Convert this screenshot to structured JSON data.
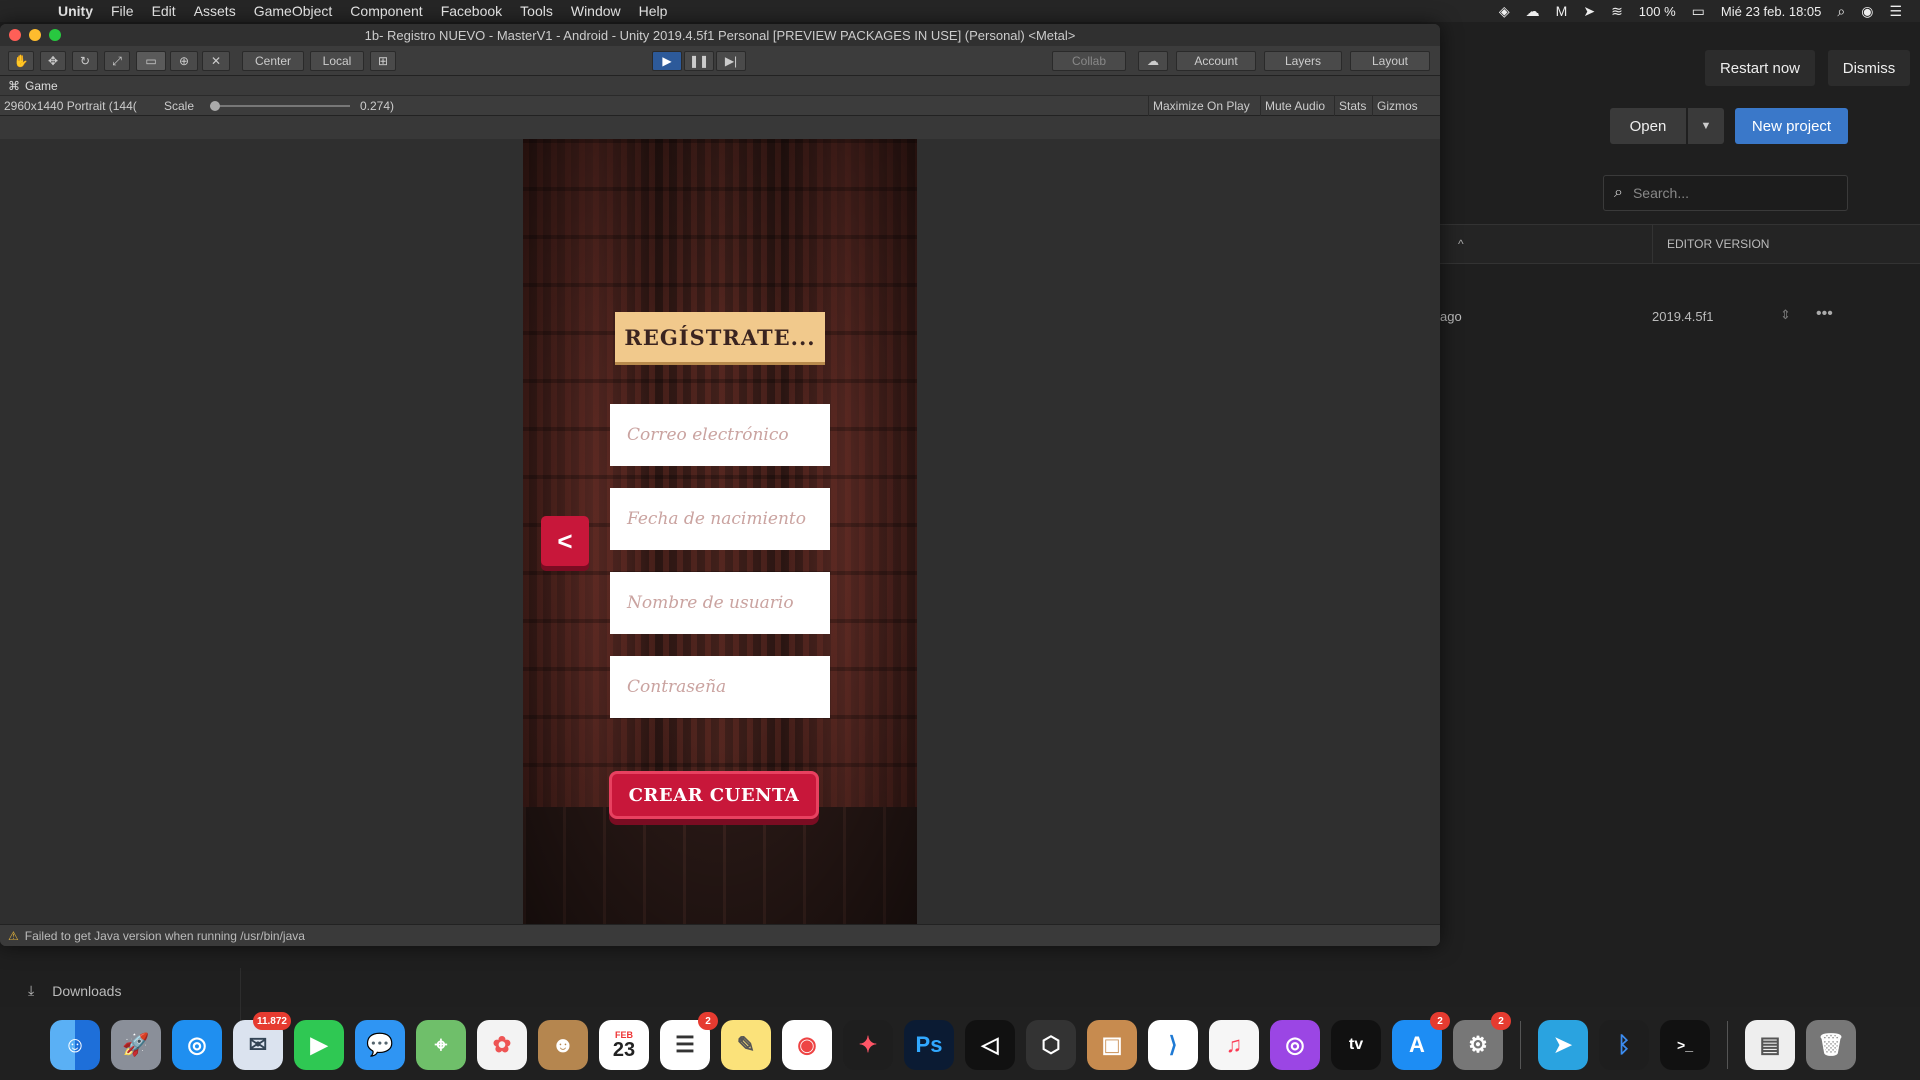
{
  "menubar": {
    "app": "Unity",
    "items": [
      "File",
      "Edit",
      "Assets",
      "GameObject",
      "Component",
      "Facebook",
      "Tools",
      "Window",
      "Help"
    ],
    "battery": "100 %",
    "datetime": "Mié 23 feb.  18:05"
  },
  "hub": {
    "restart": "Restart now",
    "dismiss": "Dismiss",
    "open": "Open",
    "new_project": "New project",
    "search_placeholder": "Search...",
    "editor_version_header": "EDITOR VERSION",
    "row_ago": "ago",
    "row_version": "2019.4.5f1",
    "downloads": "Downloads"
  },
  "unity": {
    "title": "1b- Registro NUEVO - MasterV1 - Android - Unity 2019.4.5f1 Personal [PREVIEW PACKAGES IN USE] (Personal) <Metal>",
    "toolbar": {
      "center": "Center",
      "local": "Local",
      "collab": "Collab",
      "account": "Account",
      "layers": "Layers",
      "layout": "Layout"
    },
    "game_tab": "Game",
    "gamebar": {
      "resolution": "2960x1440 Portrait (144(",
      "scale_label": "Scale",
      "scale_value": "0.274)",
      "maximize": "Maximize On Play",
      "mute": "Mute Audio",
      "stats": "Stats",
      "gizmos": "Gizmos"
    },
    "status": "Failed to get Java version when running /usr/bin/java"
  },
  "game": {
    "title": "REGÍSTRATE...",
    "email_placeholder": "Correo electrónico",
    "birth_placeholder": "Fecha de nacimiento",
    "username_placeholder": "Nombre de usuario",
    "password_placeholder": "Contraseña",
    "create_button": "CREAR CUENTA"
  },
  "dock": {
    "mail_badge": "11.872",
    "calendar_month": "FEB",
    "calendar_day": "23",
    "reminders_badge": "2",
    "appstore_badge": "2",
    "prefs_badge": "2"
  },
  "colors": {
    "accent": "#3a78c9",
    "game_red": "#c8173a",
    "plank": "#f1c98c"
  }
}
